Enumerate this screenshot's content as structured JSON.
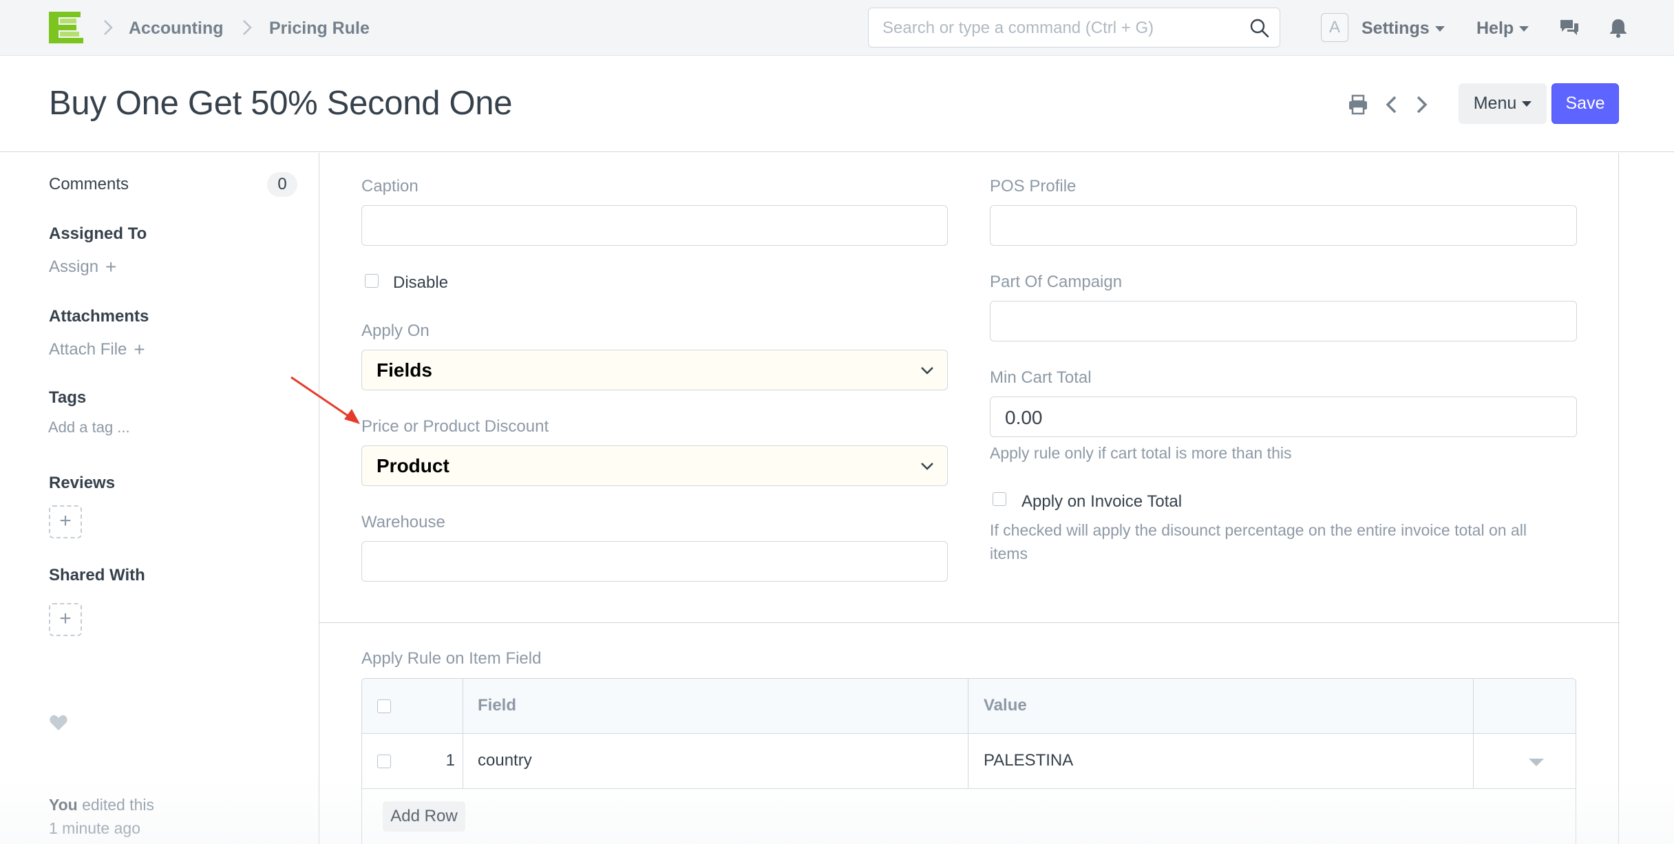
{
  "navbar": {
    "breadcrumbs": [
      "Accounting",
      "Pricing Rule"
    ],
    "search_placeholder": "Search or type a command (Ctrl + G)",
    "avatar_letter": "A",
    "settings_label": "Settings",
    "help_label": "Help"
  },
  "page": {
    "title": "Buy One Get 50% Second One",
    "menu_label": "Menu",
    "save_label": "Save"
  },
  "sidebar": {
    "comments_label": "Comments",
    "comments_count": "0",
    "assigned_to_label": "Assigned To",
    "assign_label": "Assign",
    "attachments_label": "Attachments",
    "attach_label": "Attach File",
    "tags_label": "Tags",
    "add_tag_label": "Add a tag ...",
    "reviews_label": "Reviews",
    "shared_with_label": "Shared With",
    "footer_user": "You",
    "footer_action": " edited this",
    "footer_time": "1 minute ago"
  },
  "form": {
    "caption_label": "Caption",
    "caption_value": "",
    "disable_label": "Disable",
    "apply_on_label": "Apply On",
    "apply_on_value": "Fields",
    "price_or_product_label": "Price or Product Discount",
    "price_or_product_value": "Product",
    "warehouse_label": "Warehouse",
    "warehouse_value": "",
    "pos_profile_label": "POS Profile",
    "pos_profile_value": "",
    "campaign_label": "Part Of Campaign",
    "campaign_value": "",
    "min_cart_label": "Min Cart Total",
    "min_cart_value": "0.00",
    "min_cart_help": "Apply rule only if cart total is more than this",
    "invoice_total_label": "Apply on Invoice Total",
    "invoice_total_help_1": "If checked will apply the disounct percentage on the entire invoice total on all",
    "invoice_total_help_2": "items"
  },
  "item_field_table": {
    "label": "Apply Rule on Item Field",
    "columns": [
      "Field",
      "Value"
    ],
    "rows": [
      {
        "index": "1",
        "field": "country",
        "value": "PALESTINA"
      }
    ],
    "add_row_label": "Add Row"
  },
  "colors": {
    "accent": "#5e64ff",
    "logo_green": "#7cc420",
    "arrow_red": "#e53b2c"
  }
}
